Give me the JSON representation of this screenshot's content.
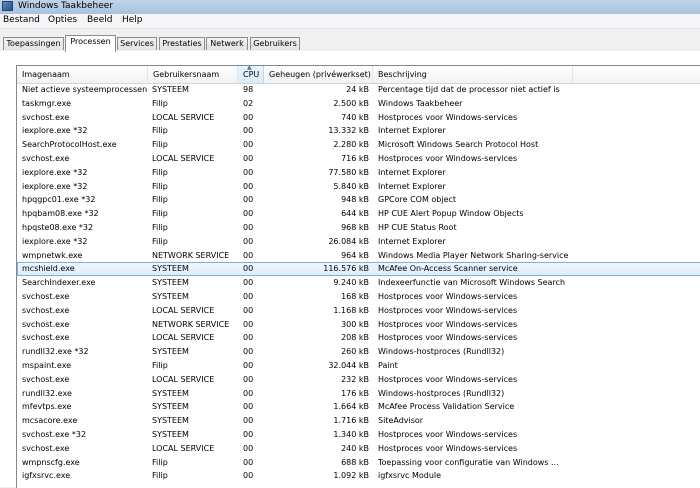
{
  "window": {
    "title": "Windows Taakbeheer"
  },
  "menu": [
    "Bestand",
    "Opties",
    "Beeld",
    "Help"
  ],
  "tabs": [
    {
      "label": "Toepassingen",
      "active": false
    },
    {
      "label": "Processen",
      "active": true
    },
    {
      "label": "Services",
      "active": false
    },
    {
      "label": "Prestaties",
      "active": false
    },
    {
      "label": "Netwerk",
      "active": false
    },
    {
      "label": "Gebruikers",
      "active": false
    }
  ],
  "columns": {
    "name": "Imagenaam",
    "user": "Gebruikersnaam",
    "cpu": "CPU",
    "memory": "Geheugen (privéwerkset)",
    "description": "Beschrijving"
  },
  "sorted_column": "cpu",
  "rows": [
    {
      "name": "Niet actieve systeemprocessen",
      "user": "SYSTEEM",
      "cpu": "98",
      "memory": "24 kB",
      "description": "Percentage tijd dat de processor niet actief is"
    },
    {
      "name": "taskmgr.exe",
      "user": "Filip",
      "cpu": "02",
      "memory": "2.500 kB",
      "description": "Windows Taakbeheer"
    },
    {
      "name": "svchost.exe",
      "user": "LOCAL SERVICE",
      "cpu": "00",
      "memory": "740 kB",
      "description": "Hostproces voor Windows-services"
    },
    {
      "name": "iexplore.exe *32",
      "user": "Filip",
      "cpu": "00",
      "memory": "13.332 kB",
      "description": "Internet Explorer"
    },
    {
      "name": "SearchProtocolHost.exe",
      "user": "Filip",
      "cpu": "00",
      "memory": "2.280 kB",
      "description": "Microsoft Windows Search Protocol Host"
    },
    {
      "name": "svchost.exe",
      "user": "LOCAL SERVICE",
      "cpu": "00",
      "memory": "716 kB",
      "description": "Hostproces voor Windows-services"
    },
    {
      "name": "iexplore.exe *32",
      "user": "Filip",
      "cpu": "00",
      "memory": "77.580 kB",
      "description": "Internet Explorer"
    },
    {
      "name": "iexplore.exe *32",
      "user": "Filip",
      "cpu": "00",
      "memory": "5.840 kB",
      "description": "Internet Explorer"
    },
    {
      "name": "hpqgpc01.exe *32",
      "user": "Filip",
      "cpu": "00",
      "memory": "948 kB",
      "description": "GPCore COM object"
    },
    {
      "name": "hpqbam08.exe *32",
      "user": "Filip",
      "cpu": "00",
      "memory": "644 kB",
      "description": "HP CUE Alert Popup Window Objects"
    },
    {
      "name": "hpqste08.exe *32",
      "user": "Filip",
      "cpu": "00",
      "memory": "968 kB",
      "description": "HP CUE Status Root"
    },
    {
      "name": "iexplore.exe *32",
      "user": "Filip",
      "cpu": "00",
      "memory": "26.084 kB",
      "description": "Internet Explorer"
    },
    {
      "name": "wmpnetwk.exe",
      "user": "NETWORK SERVICE",
      "cpu": "00",
      "memory": "964 kB",
      "description": "Windows Media Player Network Sharing-service"
    },
    {
      "name": "mcshield.exe",
      "user": "SYSTEEM",
      "cpu": "00",
      "memory": "116.576 kB",
      "description": "McAfee On-Access Scanner service",
      "selected": true
    },
    {
      "name": "SearchIndexer.exe",
      "user": "SYSTEEM",
      "cpu": "00",
      "memory": "9.240 kB",
      "description": "Indexeerfunctie van Microsoft Windows Search"
    },
    {
      "name": "svchost.exe",
      "user": "SYSTEEM",
      "cpu": "00",
      "memory": "168 kB",
      "description": "Hostproces voor Windows-services"
    },
    {
      "name": "svchost.exe",
      "user": "LOCAL SERVICE",
      "cpu": "00",
      "memory": "1.168 kB",
      "description": "Hostproces voor Windows-services"
    },
    {
      "name": "svchost.exe",
      "user": "NETWORK SERVICE",
      "cpu": "00",
      "memory": "300 kB",
      "description": "Hostproces voor Windows-services"
    },
    {
      "name": "svchost.exe",
      "user": "LOCAL SERVICE",
      "cpu": "00",
      "memory": "208 kB",
      "description": "Hostproces voor Windows-services"
    },
    {
      "name": "rundll32.exe *32",
      "user": "SYSTEEM",
      "cpu": "00",
      "memory": "260 kB",
      "description": "Windows-hostproces (Rundll32)"
    },
    {
      "name": "mspaint.exe",
      "user": "Filip",
      "cpu": "00",
      "memory": "32.044 kB",
      "description": "Paint"
    },
    {
      "name": "svchost.exe",
      "user": "LOCAL SERVICE",
      "cpu": "00",
      "memory": "232 kB",
      "description": "Hostproces voor Windows-services"
    },
    {
      "name": "rundll32.exe",
      "user": "SYSTEEM",
      "cpu": "00",
      "memory": "176 kB",
      "description": "Windows-hostproces (Rundll32)"
    },
    {
      "name": "mfevtps.exe",
      "user": "SYSTEEM",
      "cpu": "00",
      "memory": "1.664 kB",
      "description": "McAfee Process Validation Service"
    },
    {
      "name": "mcsacore.exe",
      "user": "SYSTEEM",
      "cpu": "00",
      "memory": "1.716 kB",
      "description": "SiteAdvisor"
    },
    {
      "name": "svchost.exe *32",
      "user": "SYSTEEM",
      "cpu": "00",
      "memory": "1.340 kB",
      "description": "Hostproces voor Windows-services"
    },
    {
      "name": "svchost.exe",
      "user": "LOCAL SERVICE",
      "cpu": "00",
      "memory": "240 kB",
      "description": "Hostproces voor Windows-services"
    },
    {
      "name": "wmpnscfg.exe",
      "user": "Filip",
      "cpu": "00",
      "memory": "688 kB",
      "description": "Toepassing voor configuratie van Windows ..."
    },
    {
      "name": "igfxsrvc.exe",
      "user": "Filip",
      "cpu": "00",
      "memory": "1.092 kB",
      "description": "igfxsrvc Module"
    }
  ]
}
